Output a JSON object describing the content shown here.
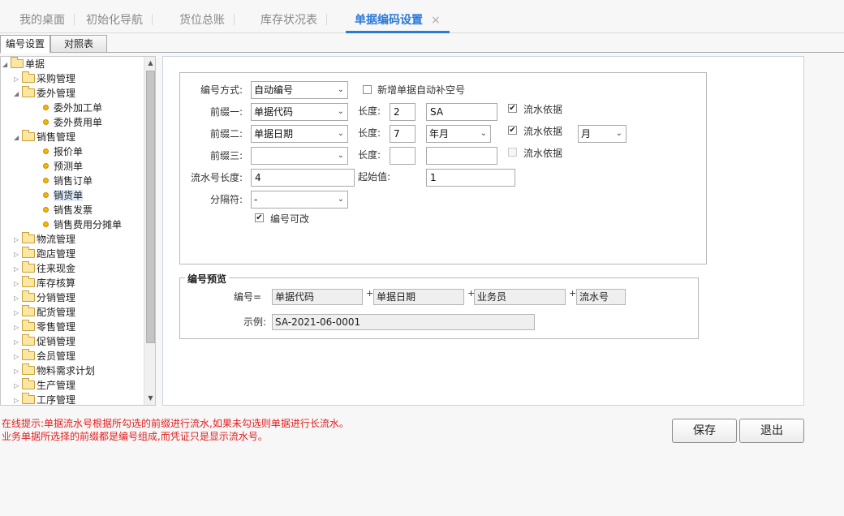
{
  "top_tabs": [
    "我的桌面",
    "初始化导航",
    "货位总账",
    "库存状况表",
    "单据编码设置"
  ],
  "close_glyph": "×",
  "sub_tabs": [
    "编号设置",
    "对照表"
  ],
  "tree": {
    "root": "单据",
    "items": [
      "采购管理",
      "委外管理",
      "委外加工单",
      "委外费用单",
      "销售管理",
      "报价单",
      "预测单",
      "销售订单",
      "销货单",
      "销售发票",
      "销售费用分摊单",
      "物流管理",
      "跑店管理",
      "往来现金",
      "库存核算",
      "分销管理",
      "配货管理",
      "零售管理",
      "促销管理",
      "会员管理",
      "物料需求计划",
      "生产管理",
      "工序管理"
    ]
  },
  "form": {
    "mode_label": "编号方式:",
    "mode_value": "自动编号",
    "auto_fill_label": "新增单据自动补空号",
    "prefix1_label": "前缀一:",
    "prefix1_value": "单据代码",
    "prefix2_label": "前缀二:",
    "prefix2_value": "单据日期",
    "prefix3_label": "前缀三:",
    "prefix3_value": "",
    "length_label": "长度:",
    "len1": "2",
    "len2": "7",
    "len3": "",
    "code1": "SA",
    "date_fmt": "年月",
    "code3": "",
    "serial_basis_label": "流水依据",
    "month_value": "月",
    "serial_len_label": "流水号长度:",
    "serial_len_value": "4",
    "start_label": "起始值:",
    "start_value": "1",
    "sep_label": "分隔符:",
    "sep_value": "-",
    "editable_label": "编号可改"
  },
  "preview": {
    "title": "编号预览",
    "code_label": "编号=",
    "parts": [
      "单据代码",
      "单据日期",
      "业务员",
      "流水号"
    ],
    "plus": "+",
    "example_label": "示例:",
    "example_value": "SA-2021-06-0001"
  },
  "hints": [
    "在线提示:单据流水号根据所勾选的前缀进行流水,如果未勾选则单据进行长流水。",
    "业务单据所选择的前缀都是编号组成,而凭证只是显示流水号。"
  ],
  "buttons": {
    "save": "保存",
    "exit": "退出"
  },
  "glyphs": {
    "expanded": "◢",
    "collapsed": "▷",
    "check": "✔",
    "dropdown": "⌄",
    "up": "▲",
    "down": "▼"
  }
}
